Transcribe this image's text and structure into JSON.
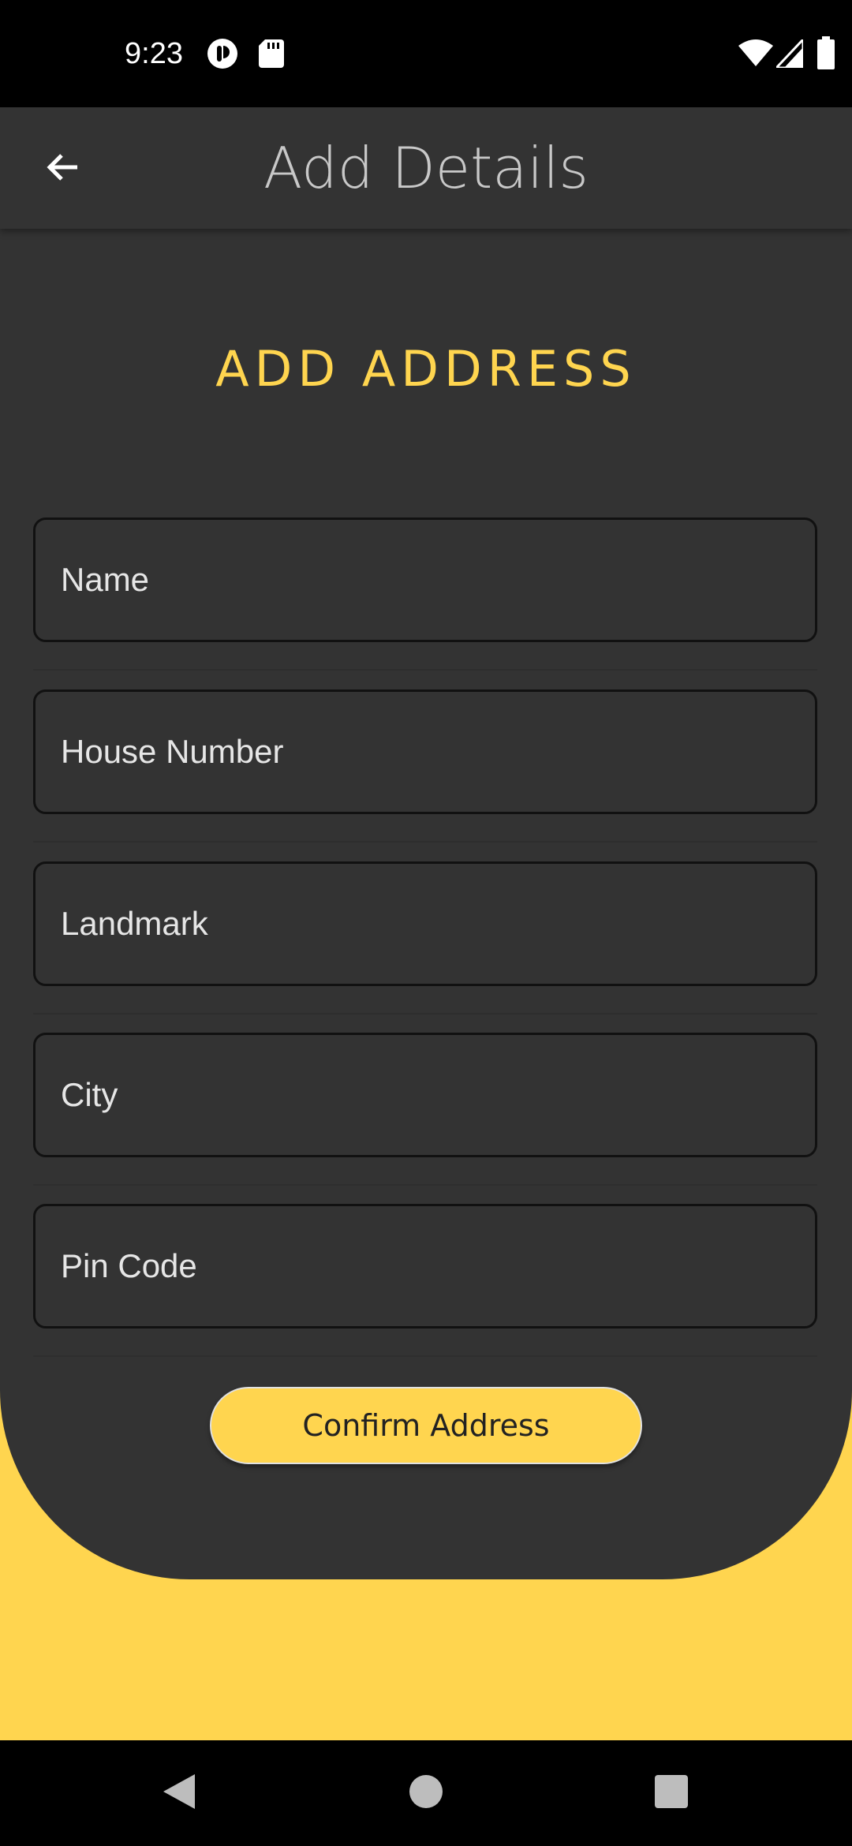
{
  "status_bar": {
    "time": "9:23",
    "left_icons": [
      "podcast-app-icon",
      "sd-card-icon"
    ],
    "right_icons": [
      "wifi-icon",
      "cell-signal-icon",
      "battery-icon"
    ]
  },
  "app_bar": {
    "title": "Add Details",
    "back_icon": "arrow-back-icon"
  },
  "form": {
    "heading": "ADD ADDRESS",
    "fields": [
      {
        "name": "name-field",
        "placeholder": "Name",
        "value": ""
      },
      {
        "name": "house-number-field",
        "placeholder": "House Number",
        "value": ""
      },
      {
        "name": "landmark-field",
        "placeholder": "Landmark",
        "value": ""
      },
      {
        "name": "city-field",
        "placeholder": "City",
        "value": ""
      },
      {
        "name": "pin-code-field",
        "placeholder": "Pin Code",
        "value": ""
      }
    ],
    "confirm_label": "Confirm Address"
  },
  "nav_bar": {
    "icons": [
      "back-triangle-icon",
      "home-circle-icon",
      "recents-square-icon"
    ]
  },
  "colors": {
    "accent": "#ffd54f",
    "surface": "#333333",
    "system_bar": "#000000",
    "title_text": "#c8c8c8"
  }
}
